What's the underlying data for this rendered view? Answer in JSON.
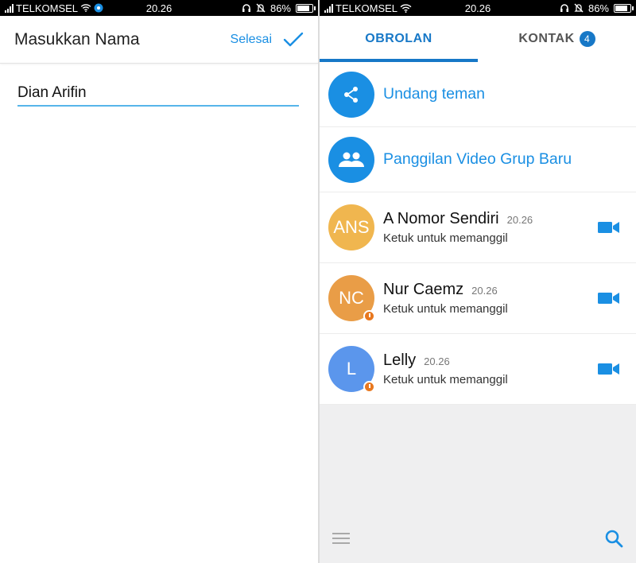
{
  "status_bar": {
    "carrier": "TELKOMSEL",
    "time": "20.26",
    "battery": "86%",
    "battery_level": 0.86
  },
  "left_screen": {
    "title": "Masukkan Nama",
    "done_label": "Selesai",
    "name_value": "Dian Arifin"
  },
  "right_screen": {
    "tabs": [
      {
        "label": "OBROLAN",
        "active": true
      },
      {
        "label": "KONTAK",
        "badge": "4",
        "active": false
      }
    ],
    "actions": [
      {
        "label": "Undang teman",
        "icon": "share-icon"
      },
      {
        "label": "Panggilan Video Grup Baru",
        "icon": "group-icon"
      }
    ],
    "contacts": [
      {
        "initials": "ANS",
        "name": "A Nomor Sendiri",
        "time": "20.26",
        "subtitle": "Ketuk untuk memanggil",
        "avatar_color": "#f0b64f",
        "has_badge": false
      },
      {
        "initials": "NC",
        "name": "Nur Caemz",
        "time": "20.26",
        "subtitle": "Ketuk untuk memanggil",
        "avatar_color": "#e99d47",
        "has_badge": true
      },
      {
        "initials": "L",
        "name": "Lelly",
        "time": "20.26",
        "subtitle": "Ketuk untuk memanggil",
        "avatar_color": "#5b96ec",
        "has_badge": true
      }
    ]
  },
  "colors": {
    "accent": "#1a8fe3",
    "tab_active": "#1778c7",
    "list_background": "#efeff0"
  }
}
